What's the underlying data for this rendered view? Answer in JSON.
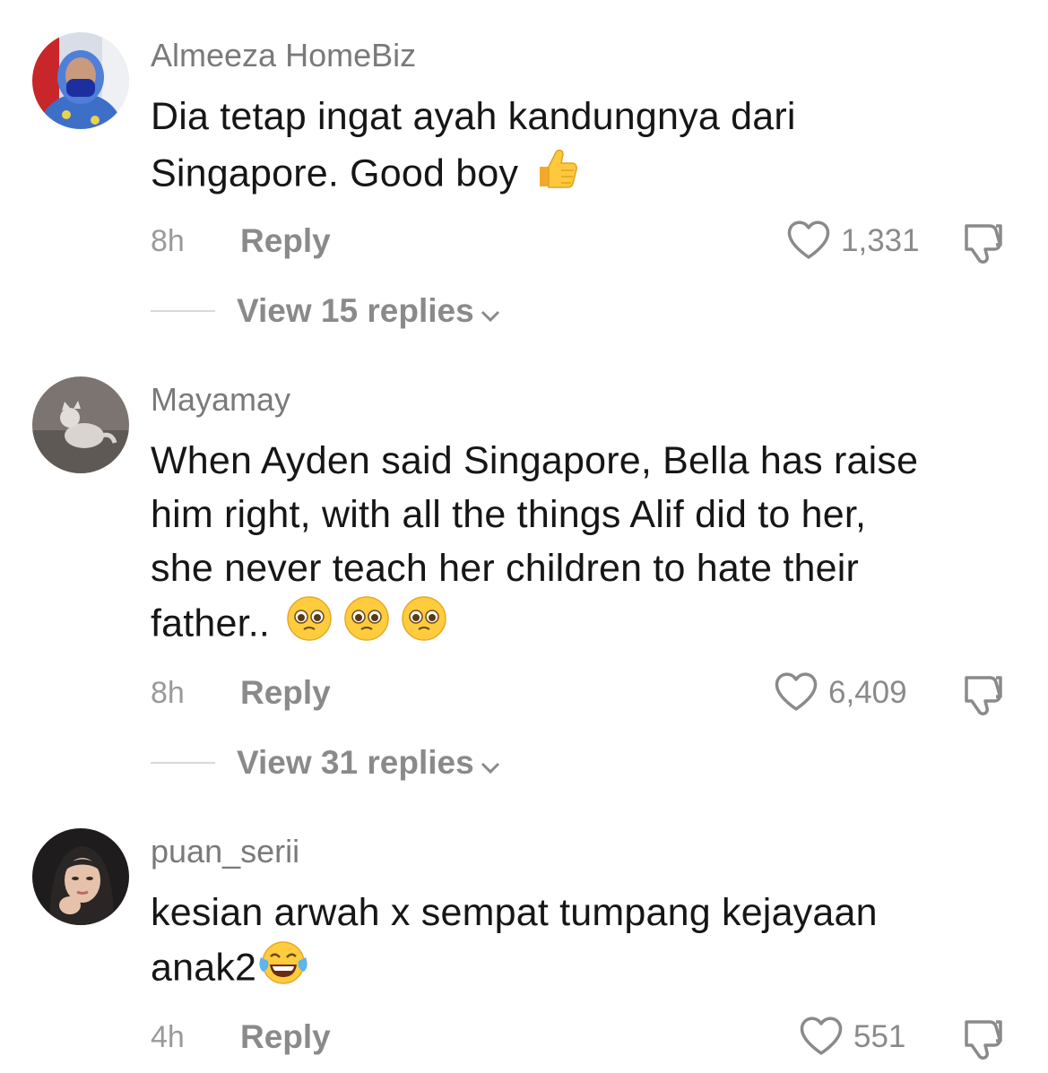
{
  "comments": [
    {
      "username": "Almeeza HomeBiz",
      "text_lines": [
        "Dia tetap ingat ayah kandungnya dari",
        "Singapore. Good boy"
      ],
      "emoji": "thumbs-up",
      "time": "8h",
      "reply_label": "Reply",
      "likes": "1,331",
      "view_replies": "View 15 replies"
    },
    {
      "username": "Mayamay",
      "text_lines": [
        "When Ayden said Singapore, Bella has raise",
        "him right, with all the things Alif did to her,",
        "she never teach her children to hate their",
        "father.."
      ],
      "emoji": "pleading-face x3",
      "time": "8h",
      "reply_label": "Reply",
      "likes": "6,409",
      "view_replies": "View 31 replies"
    },
    {
      "username": "puan_serii",
      "text_lines": [
        "kesian arwah x sempat tumpang kejayaan",
        "anak2"
      ],
      "emoji": "face-with-tears-of-joy",
      "time": "4h",
      "reply_label": "Reply",
      "likes": "551"
    }
  ],
  "icons": {
    "like": "heart-outline-icon",
    "dislike": "thumbs-down-outline-icon",
    "expand": "chevron-down-icon"
  },
  "colors": {
    "text": "#161616",
    "username": "#7a7a7a",
    "meta": "#8a8a8a"
  }
}
